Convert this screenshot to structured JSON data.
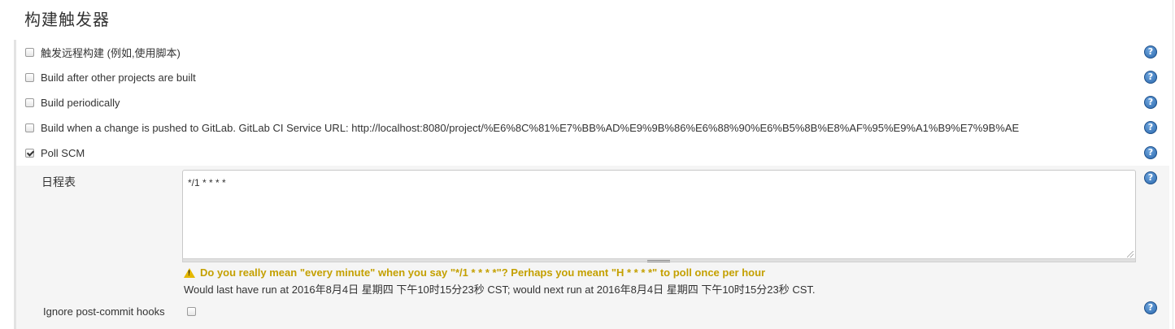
{
  "section": {
    "title": "构建触发器"
  },
  "triggers": [
    {
      "label": "触发远程构建 (例如,使用脚本)",
      "checked": false
    },
    {
      "label": "Build after other projects are built",
      "checked": false
    },
    {
      "label": "Build periodically",
      "checked": false
    },
    {
      "label": "Build when a change is pushed to GitLab. GitLab CI Service URL: http://localhost:8080/project/%E6%8C%81%E7%BB%AD%E9%9B%86%E6%88%90%E6%B5%8B%E8%AF%95%E9%A1%B9%E7%9B%AE",
      "checked": false
    },
    {
      "label": "Poll SCM",
      "checked": true
    }
  ],
  "schedule": {
    "label": "日程表",
    "value": "*/1 * * * *",
    "warning": "Do you really mean \"every minute\" when you say \"*/1 * * * *\"? Perhaps you meant \"H * * * *\" to poll once per hour",
    "info": "Would last have run at 2016年8月4日 星期四 下午10时15分23秒 CST; would next run at 2016年8月4日 星期四 下午10时15分23秒 CST."
  },
  "ignore_hooks": {
    "label": "Ignore post-commit hooks",
    "checked": false
  },
  "help_icon": {
    "glyph": "?"
  },
  "colors": {
    "warning": "#c4a000",
    "help": "#2b68ad",
    "panel": "#f5f5f5"
  }
}
